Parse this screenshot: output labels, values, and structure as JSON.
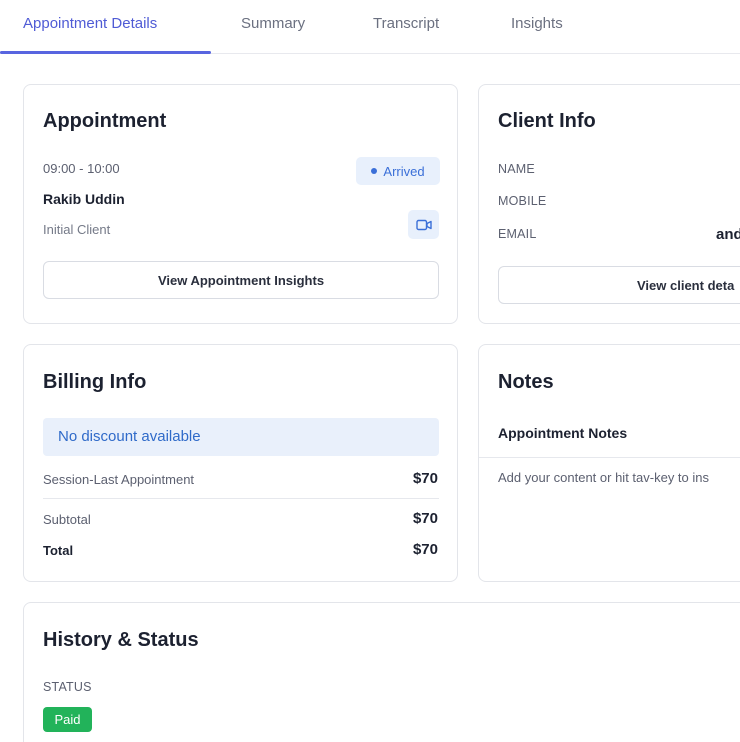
{
  "tabs": [
    {
      "label": "Appointment Details",
      "active": true
    },
    {
      "label": "Summary",
      "active": false
    },
    {
      "label": "Transcript",
      "active": false
    },
    {
      "label": "Insights",
      "active": false
    }
  ],
  "appointment": {
    "title": "Appointment",
    "time": "09:00 - 10:00",
    "status": "Arrived",
    "client_name": "Rakib Uddin",
    "client_type": "Initial Client",
    "insights_button": "View Appointment Insights"
  },
  "client_info": {
    "title": "Client Info",
    "name_label": "NAME",
    "mobile_label": "MOBILE",
    "email_label": "EMAIL",
    "email_value_partial": "and",
    "details_button": "View client deta"
  },
  "billing": {
    "title": "Billing Info",
    "discount_text": "No discount available",
    "session_label": "Session-Last Appointment",
    "session_value": "$70",
    "subtotal_label": "Subtotal",
    "subtotal_value": "$70",
    "total_label": "Total",
    "total_value": "$70"
  },
  "notes": {
    "title": "Notes",
    "section_title": "Appointment Notes",
    "placeholder": "Add your content or hit tav-key to ins"
  },
  "history": {
    "title": "History & Status",
    "status_label": "STATUS",
    "status_value": "Paid"
  },
  "colors": {
    "accent": "#5865e0",
    "arrived_bg": "#e8f0fc",
    "arrived_text": "#3a6fd8",
    "paid_bg": "#22b35a",
    "discount_bg": "#e9f0fb"
  },
  "icons": {
    "video": "video-camera-icon",
    "status_dot": "status-dot-icon"
  }
}
